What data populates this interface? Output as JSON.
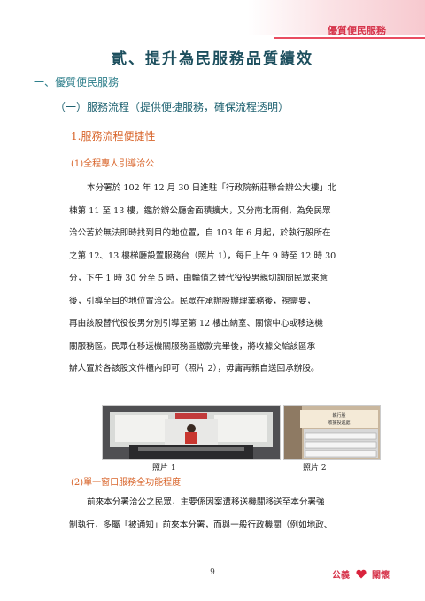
{
  "header": {
    "label": "優質便民服務"
  },
  "doc": {
    "title": "貳、提升為民服務品質績效",
    "section1": "一、優質便民服務",
    "section2": "（一）服務流程（提供便捷服務，確保流程透明）",
    "section3": "1.服務流程便捷性",
    "sub1": "(1)全程專人引導洽公",
    "para1_lines": [
      "本分署於 102 年 12 月 30 日進駐「行政院新莊聯合辦公大樓」北",
      "棟第 11 至 13 樓，鑑於辦公廳舍面積擴大，又分南北兩側，為免民眾",
      "洽公苦於無法即時找到目的地位置，自 103 年 6 月起，於執行股所在",
      "之第 12、13 樓梯廳設置服務台（照片 1），每日上午 9 時至 12 時 30",
      "分，下午 1 時 30 分至 5 時，由輪值之替代役役男親切詢問民眾來意",
      "後，引導至目的地位置洽公。民眾在承辦股辦理業務後，視需要，",
      "再由該股替代役役男分別引導至第 12 樓出納室、關懷中心或移送機",
      "關服務區。民眾在移送機關服務區繳款完畢後，將收據交給該區承",
      "辦人置於各該股文件櫃內即可（照片 2），毋庸再親自送回承辦股。"
    ],
    "photo1_caption": "照片 1",
    "photo2_caption": "照片 2",
    "photo2_sign": [
      "執行股",
      "收據投遞處"
    ],
    "sub2": "(2)單一窗口服務全功能程度",
    "para2_lines": [
      "前來本分署洽公之民眾，主要係因案遭移送機關移送至本分署強",
      "制執行，多屬「被通知」前來本分署，而與一般行政機關（例如地政、"
    ]
  },
  "footer": {
    "page_number": "9",
    "left": "公義",
    "right": "關懷"
  }
}
